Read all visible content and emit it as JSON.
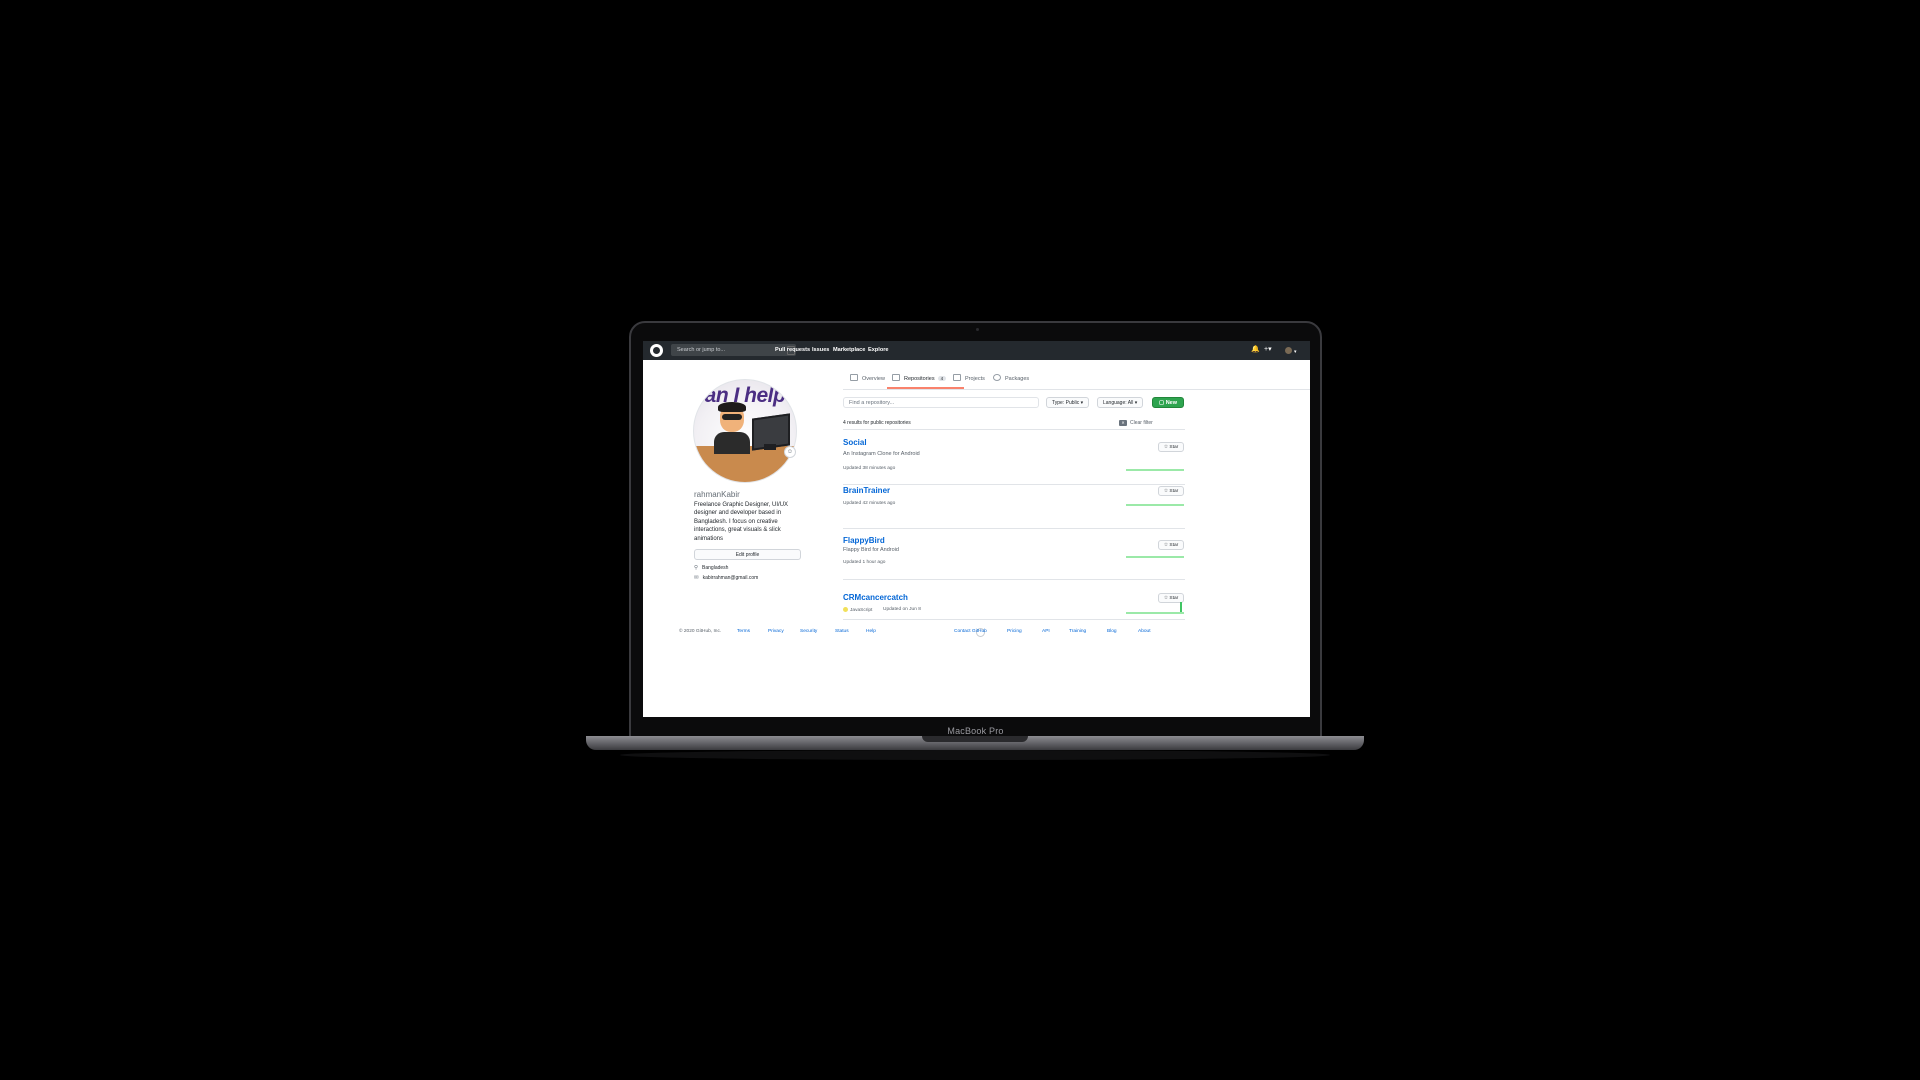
{
  "device": {
    "label": "MacBook Pro"
  },
  "header": {
    "search_placeholder": "Search or jump to...",
    "slash_key": "/",
    "nav": [
      "Pull requests",
      "Issues",
      "Marketplace",
      "Explore"
    ]
  },
  "tabs": [
    {
      "label": "Overview"
    },
    {
      "label": "Repositories",
      "count": "4"
    },
    {
      "label": "Projects"
    },
    {
      "label": "Packages"
    }
  ],
  "profile": {
    "avatar_text": "Can I help you.",
    "username": "rahmanKabir",
    "bio": "Freelance Graphic Designer, UI/UX designer and developer based in Bangladesh. I focus on creative interactions, great visuals & slick animations",
    "edit_button": "Edit profile",
    "location": "Bangladesh",
    "email": "kabirrahman@gmail.com"
  },
  "toolbar": {
    "find_placeholder": "Find a repository...",
    "type_label": "Type: Public",
    "language_label": "Language: All",
    "new_label": "New"
  },
  "results": {
    "summary": "4 results for public repositories",
    "clear_filter": "Clear filter"
  },
  "repos": [
    {
      "name": "Social",
      "description": "An Instagram Clone for Android",
      "language": "",
      "updated": "Updated 38 minutes ago",
      "star": "Star"
    },
    {
      "name": "BrainTrainer",
      "description": "",
      "language": "",
      "updated": "Updated 42 minutes ago",
      "star": "Star"
    },
    {
      "name": "FlappyBird",
      "description": "Flappy Bird for Android",
      "language": "",
      "updated": "Updated 1 hour ago",
      "star": "Star"
    },
    {
      "name": "CRMcancercatch",
      "description": "",
      "language": "JavaScript",
      "updated": "Updated on Jun 8",
      "star": "Star"
    }
  ],
  "footer": {
    "copyright": "© 2020 GitHub, Inc.",
    "left_links": [
      "Terms",
      "Privacy",
      "Security",
      "Status",
      "Help"
    ],
    "right_links": [
      "Contact GitHub",
      "Pricing",
      "API",
      "Training",
      "Blog",
      "About"
    ]
  },
  "colors": {
    "header_bg": "#24292e",
    "link": "#0366d6",
    "new_button": "#2ea44f",
    "tab_underline": "#f9826c",
    "javascript": "#f1e05a"
  }
}
